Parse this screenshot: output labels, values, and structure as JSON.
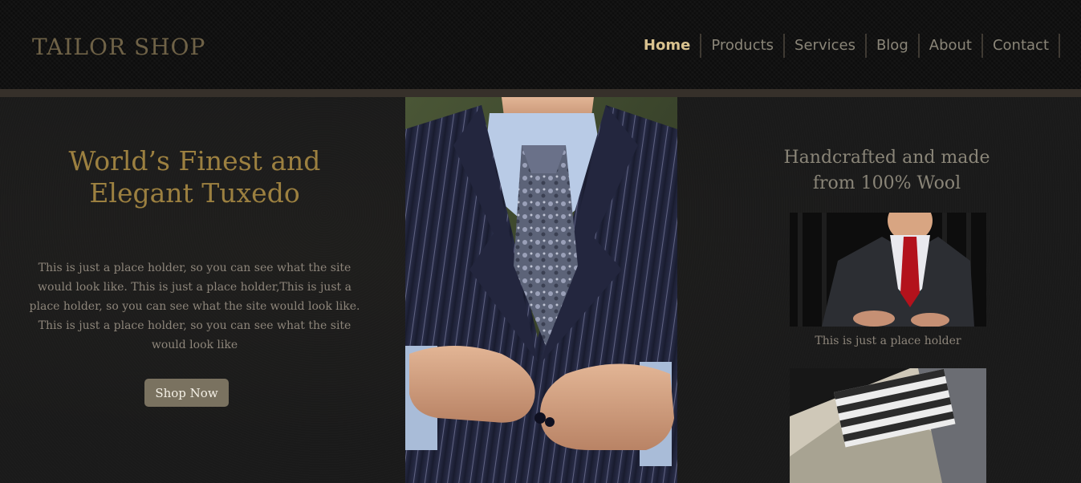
{
  "header": {
    "logo": "TAILOR SHOP",
    "nav": [
      {
        "label": "Home",
        "active": true
      },
      {
        "label": "Products",
        "active": false
      },
      {
        "label": "Services",
        "active": false
      },
      {
        "label": "Blog",
        "active": false
      },
      {
        "label": "About",
        "active": false
      },
      {
        "label": "Contact",
        "active": false
      }
    ]
  },
  "hero": {
    "title_line1": "World’s Finest and",
    "title_line2": "Elegant Tuxedo",
    "text": "This is just a place holder, so you can see what the site would look like. This is just a place holder,This is just a place holder, so you can see what the site would look like. This is just a place holder, so you can see what the site would look like",
    "button_label": "Shop Now"
  },
  "sidebar": {
    "title_line1": "Handcrafted and made",
    "title_line2": "from 100% Wool",
    "caption": "This is just a place holder"
  },
  "colors": {
    "accent_gold": "#9c8040",
    "nav_active": "#d9c28f",
    "button_bg": "#7a7260",
    "header_bar": "#36302a"
  }
}
